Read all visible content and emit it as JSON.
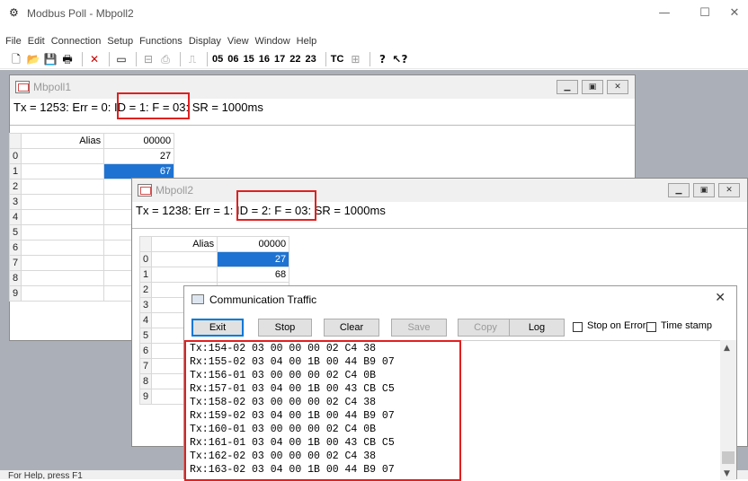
{
  "app": {
    "title": "Modbus Poll - Mbpoll2",
    "minimize": "—",
    "maximize": "☐",
    "close": "✕"
  },
  "menu": [
    "File",
    "Edit",
    "Connection",
    "Setup",
    "Functions",
    "Display",
    "View",
    "Window",
    "Help"
  ],
  "toolbar": {
    "func_codes": [
      "05",
      "06",
      "15",
      "16",
      "17",
      "22",
      "23"
    ],
    "tc_label": "TC"
  },
  "windows": {
    "mbpoll1": {
      "title": "Mbpoll1",
      "status": "Tx = 1253: Err = 0: ID = 1: F = 03: SR = 1000ms",
      "alias_header": "Alias",
      "col_header": "00000",
      "rows": [
        {
          "num": "0",
          "value": "27",
          "selected": false
        },
        {
          "num": "1",
          "value": "67",
          "selected": true
        },
        {
          "num": "2",
          "value": "",
          "selected": false
        },
        {
          "num": "3",
          "value": "",
          "selected": false
        },
        {
          "num": "4",
          "value": "",
          "selected": false
        },
        {
          "num": "5",
          "value": "",
          "selected": false
        },
        {
          "num": "6",
          "value": "",
          "selected": false
        },
        {
          "num": "7",
          "value": "",
          "selected": false
        },
        {
          "num": "8",
          "value": "",
          "selected": false
        },
        {
          "num": "9",
          "value": "",
          "selected": false
        }
      ]
    },
    "mbpoll2": {
      "title": "Mbpoll2",
      "status": "Tx = 1238: Err = 1: ID = 2: F = 03: SR = 1000ms",
      "alias_header": "Alias",
      "col_header": "00000",
      "rows": [
        {
          "num": "0",
          "value": "27",
          "selected": true
        },
        {
          "num": "1",
          "value": "68",
          "selected": false
        },
        {
          "num": "2",
          "value": "",
          "selected": false
        },
        {
          "num": "3",
          "value": "",
          "selected": false
        },
        {
          "num": "4",
          "value": "",
          "selected": false
        },
        {
          "num": "5",
          "value": "",
          "selected": false
        },
        {
          "num": "6",
          "value": "",
          "selected": false
        },
        {
          "num": "7",
          "value": "",
          "selected": false
        },
        {
          "num": "8",
          "value": "",
          "selected": false
        },
        {
          "num": "9",
          "value": "",
          "selected": false
        }
      ]
    }
  },
  "traffic": {
    "title": "Communication Traffic",
    "buttons": {
      "exit": "Exit",
      "stop": "Stop",
      "clear": "Clear",
      "save": "Save",
      "copy": "Copy",
      "log": "Log"
    },
    "stop_on_error": "Stop on Error",
    "time_stamp": "Time stamp",
    "lines": [
      "Tx:154-02 03 00 00 00 02 C4 38",
      "Rx:155-02 03 04 00 1B 00 44 B9 07",
      "Tx:156-01 03 00 00 00 02 C4 0B",
      "Rx:157-01 03 04 00 1B 00 43 CB C5",
      "Tx:158-02 03 00 00 00 02 C4 38",
      "Rx:159-02 03 04 00 1B 00 44 B9 07",
      "Tx:160-01 03 00 00 00 02 C4 0B",
      "Rx:161-01 03 04 00 1B 00 43 CB C5",
      "Tx:162-02 03 00 00 00 02 C4 38",
      "Rx:163-02 03 04 00 1B 00 44 B9 07"
    ]
  },
  "statusbar": {
    "text": "For Help, press F1"
  },
  "colors": {
    "highlight_box": "#e02020",
    "selection": "#1e73d2",
    "mdi_background": "#abb0b8"
  }
}
